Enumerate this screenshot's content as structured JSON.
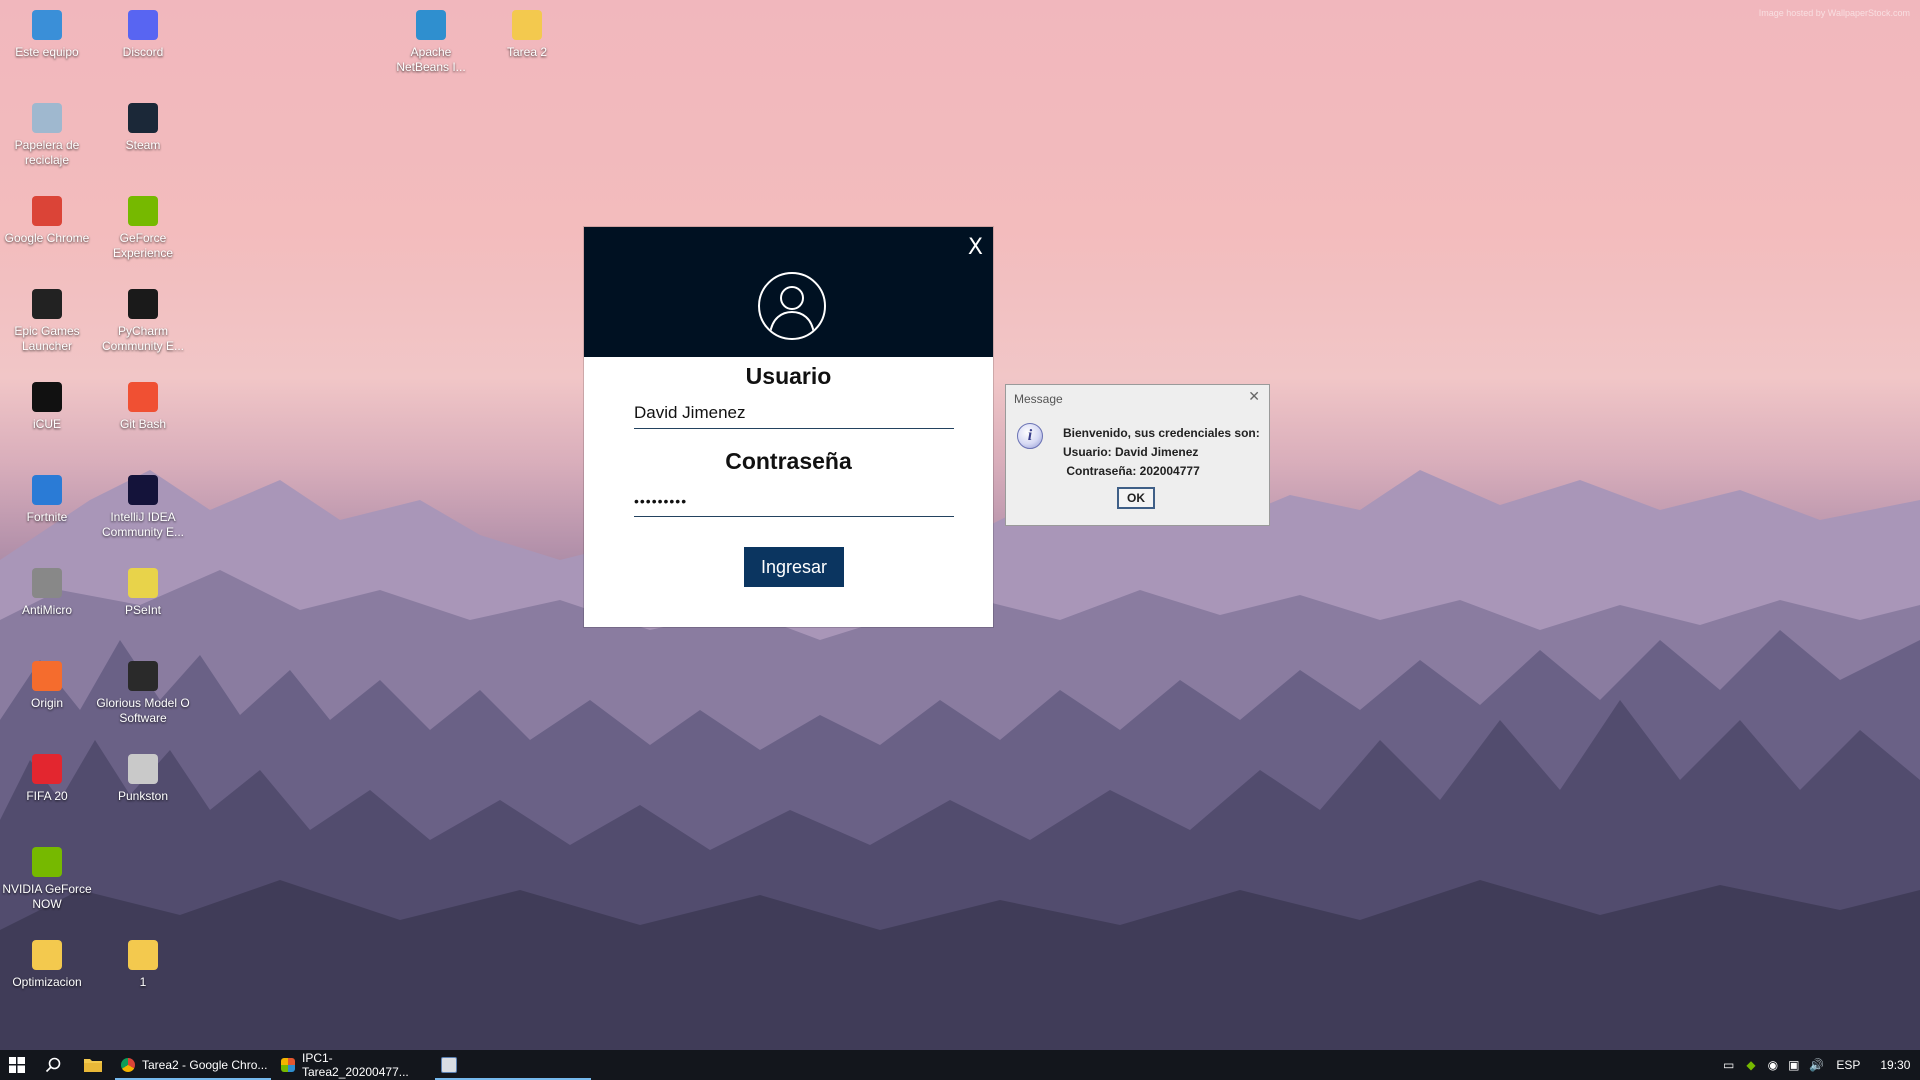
{
  "wallpaper": {
    "credit": "Image hosted by WallpaperStock.com"
  },
  "desktop_icons": [
    {
      "label": "Este equipo",
      "icon": "computer-icon",
      "color": "#3a8fd8"
    },
    {
      "label": "Discord",
      "icon": "discord-icon",
      "color": "#5865f2"
    },
    {
      "label": "Apache NetBeans I...",
      "icon": "netbeans-icon",
      "color": "#2f8fcf"
    },
    {
      "label": "Tarea 2",
      "icon": "folder-icon",
      "color": "#f3c94e"
    },
    {
      "label": "Papelera de reciclaje",
      "icon": "recycle-bin-icon",
      "color": "#9fb8cf"
    },
    {
      "label": "Steam",
      "icon": "steam-icon",
      "color": "#1b2838"
    },
    {
      "label": "Google Chrome",
      "icon": "chrome-icon",
      "color": "#db4437"
    },
    {
      "label": "GeForce Experience",
      "icon": "geforce-icon",
      "color": "#76b900"
    },
    {
      "label": "Epic Games Launcher",
      "icon": "epic-games-icon",
      "color": "#222222"
    },
    {
      "label": "PyCharm Community E...",
      "icon": "pycharm-icon",
      "color": "#1a1a1a"
    },
    {
      "label": "iCUE",
      "icon": "icue-icon",
      "color": "#111111"
    },
    {
      "label": "Git Bash",
      "icon": "git-bash-icon",
      "color": "#f05033"
    },
    {
      "label": "Fortnite",
      "icon": "fortnite-icon",
      "color": "#2a7bd6"
    },
    {
      "label": "IntelliJ IDEA Community E...",
      "icon": "intellij-icon",
      "color": "#14133a"
    },
    {
      "label": "AntiMicro",
      "icon": "gamepad-icon",
      "color": "#888888"
    },
    {
      "label": "PSeInt",
      "icon": "pseint-icon",
      "color": "#e8d34a"
    },
    {
      "label": "Origin",
      "icon": "origin-icon",
      "color": "#f56c2d"
    },
    {
      "label": "Glorious Model O Software",
      "icon": "mouse-icon",
      "color": "#2a2a2a"
    },
    {
      "label": "FIFA 20",
      "icon": "fifa-icon",
      "color": "#e3262f"
    },
    {
      "label": "Punkston",
      "icon": "punkston-icon",
      "color": "#c9c9c9"
    },
    {
      "label": "NVIDIA GeForce NOW",
      "icon": "geforce-now-icon",
      "color": "#76b900"
    },
    {
      "label": "Optimizacion",
      "icon": "folder-icon",
      "color": "#f3c94e"
    },
    {
      "label": "1",
      "icon": "folder-icon",
      "color": "#f3c94e"
    }
  ],
  "login": {
    "user_label": "Usuario",
    "user_value": "David Jimenez",
    "password_label": "Contraseña",
    "password_value": "•••••••••",
    "submit_label": "Ingresar",
    "close_glyph": "X",
    "header_color": "#001122",
    "button_color": "#0b3560"
  },
  "message": {
    "title": "Message",
    "line1": "Bienvenido, sus credenciales son:",
    "line2": "Usuario: David Jimenez",
    "line3": " Contraseña: 202004777",
    "ok_label": "OK",
    "close_glyph": "✕"
  },
  "taskbar": {
    "apps": [
      {
        "label": "Tarea2 - Google Chro...",
        "icon": "chrome-icon",
        "active": true
      },
      {
        "label": "IPC1-Tarea2_20200477...",
        "icon": "netbeans-icon",
        "active": false
      },
      {
        "label": "",
        "icon": "java-app-icon",
        "active": true
      }
    ],
    "language": "ESP",
    "time": "19:30"
  }
}
